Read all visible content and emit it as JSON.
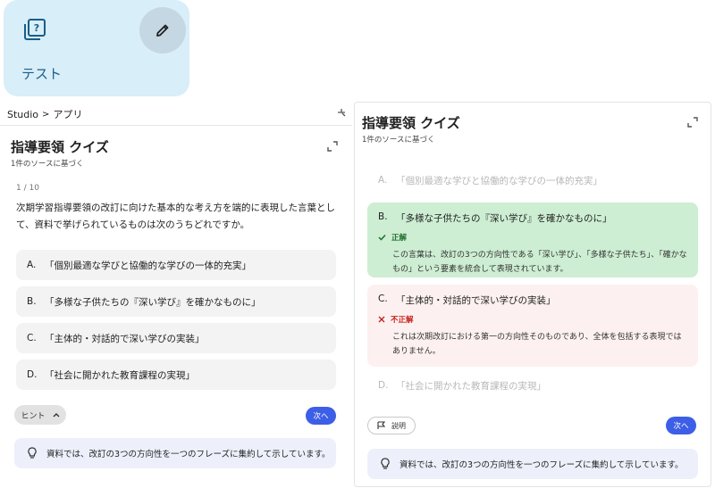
{
  "tile": {
    "label": "テスト",
    "quiz_icon": "quiz-icon",
    "edit_icon": "pencil-icon"
  },
  "breadcrumb": {
    "root": "Studio",
    "separator": ">",
    "current": "アプリ"
  },
  "quiz": {
    "title": "指導要領 クイズ",
    "source_note": "1件のソースに基づく",
    "counter": "1 / 10",
    "question": "次期学習指導要領の改訂に向けた基本的な考え方を端的に表現した言葉として、資料で挙げられているものは次のうちどれですか。",
    "options": [
      {
        "letter": "A.",
        "text": "「個別最適な学びと協働的な学びの一体的充実」"
      },
      {
        "letter": "B.",
        "text": "「多様な子供たちの『深い学び』を確かなものに」"
      },
      {
        "letter": "C.",
        "text": "「主体的・対話的で深い学びの実装」"
      },
      {
        "letter": "D.",
        "text": "「社会に開かれた教育課程の実現」"
      }
    ],
    "hint_label": "ヒント",
    "next_label": "次へ",
    "hint_text": "資料では、改訂の3つの方向性を一つのフレーズに集約して示しています。"
  },
  "result": {
    "correct_label": "正解",
    "correct_explanation": "この言葉は、改訂の3つの方向性である「深い学び」、「多様な子供たち」、「確かなもの」という要素を統合して表現されています。",
    "wrong_label": "不正解",
    "wrong_explanation": "これは次期改訂における第一の方向性そのものであり、全体を包括する表現ではありません。",
    "explain_label": "説明"
  },
  "colors": {
    "accent": "#3d5ee6",
    "correct_bg": "#cdeed3",
    "wrong_bg": "#fcf1f0",
    "hint_bg": "#edf0fb",
    "tile_bg": "#d8eef8"
  }
}
